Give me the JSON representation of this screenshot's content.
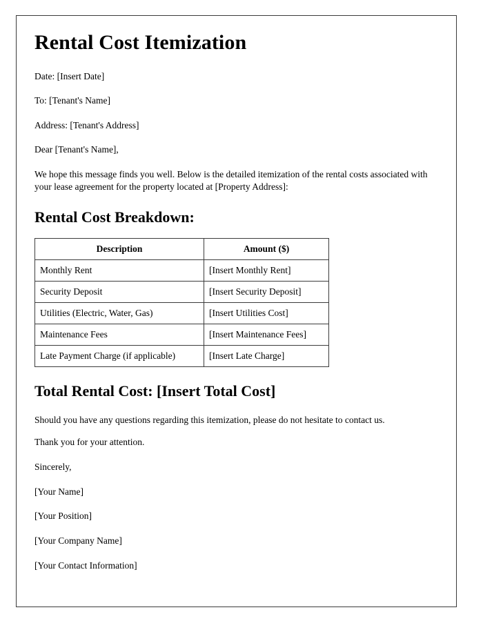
{
  "document": {
    "title": "Rental Cost Itemization",
    "header_lines": [
      "Date: [Insert Date]",
      "To: [Tenant's Name]",
      "Address: [Tenant's Address]",
      "Dear [Tenant's Name],"
    ],
    "intro_paragraph": "We hope this message finds you well. Below is the detailed itemization of the rental costs associated with your lease agreement for the property located at [Property Address]:",
    "breakdown_heading": "Rental Cost Breakdown:",
    "table": {
      "columns": [
        "Description",
        "Amount ($)"
      ],
      "rows": [
        [
          "Monthly Rent",
          "[Insert Monthly Rent]"
        ],
        [
          "Security Deposit",
          "[Insert Security Deposit]"
        ],
        [
          "Utilities (Electric, Water, Gas)",
          "[Insert Utilities Cost]"
        ],
        [
          "Maintenance Fees",
          "[Insert Maintenance Fees]"
        ],
        [
          "Late Payment Charge (if applicable)",
          "[Insert Late Charge]"
        ]
      ]
    },
    "total_heading": "Total Rental Cost: [Insert Total Cost]",
    "closing_paragraph": "Should you have any questions regarding this itemization, please do not hesitate to contact us.",
    "thanks_line": "Thank you for your attention.",
    "signoff": "Sincerely,",
    "signature_lines": [
      "[Your Name]",
      "[Your Position]",
      "[Your Company Name]",
      "[Your Contact Information]"
    ]
  },
  "colors": {
    "page_background": "#ffffff",
    "text": "#000000",
    "border": "#3a3a3a"
  }
}
